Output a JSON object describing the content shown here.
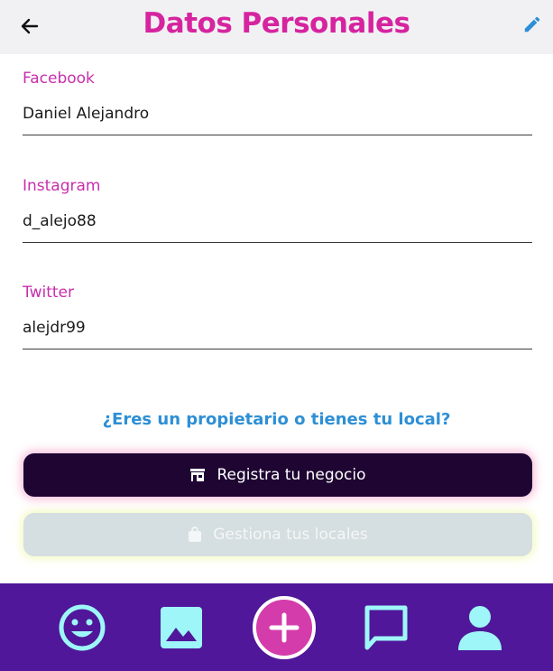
{
  "header": {
    "title": "Datos Personales",
    "back_icon": "arrow-left-icon",
    "edit_icon": "pencil-icon"
  },
  "fields": [
    {
      "label": "Facebook",
      "value": "Daniel Alejandro"
    },
    {
      "label": "Instagram",
      "value": "d_alejo88"
    },
    {
      "label": "Twitter",
      "value": "alejdr99"
    }
  ],
  "owner_section": {
    "question": "¿Eres un propietario o tienes tu local?",
    "register_button": "Registra tu negocio",
    "register_icon": "store-icon",
    "manage_button": "Gestiona tus locales",
    "manage_icon": "shopping-bag-icon"
  },
  "bottom_nav": {
    "items": [
      "smiley-icon",
      "image-icon",
      "add-circle-icon",
      "chat-icon",
      "person-icon"
    ]
  },
  "colors": {
    "title": "#d6249f",
    "label": "#c72fab",
    "link": "#2d8fd5",
    "primary_button": "#1e0532",
    "disabled_button": "#d5dee0",
    "nav_background": "#50179a",
    "nav_icon": "#9ef6f8",
    "add_button": "#d43cab"
  }
}
